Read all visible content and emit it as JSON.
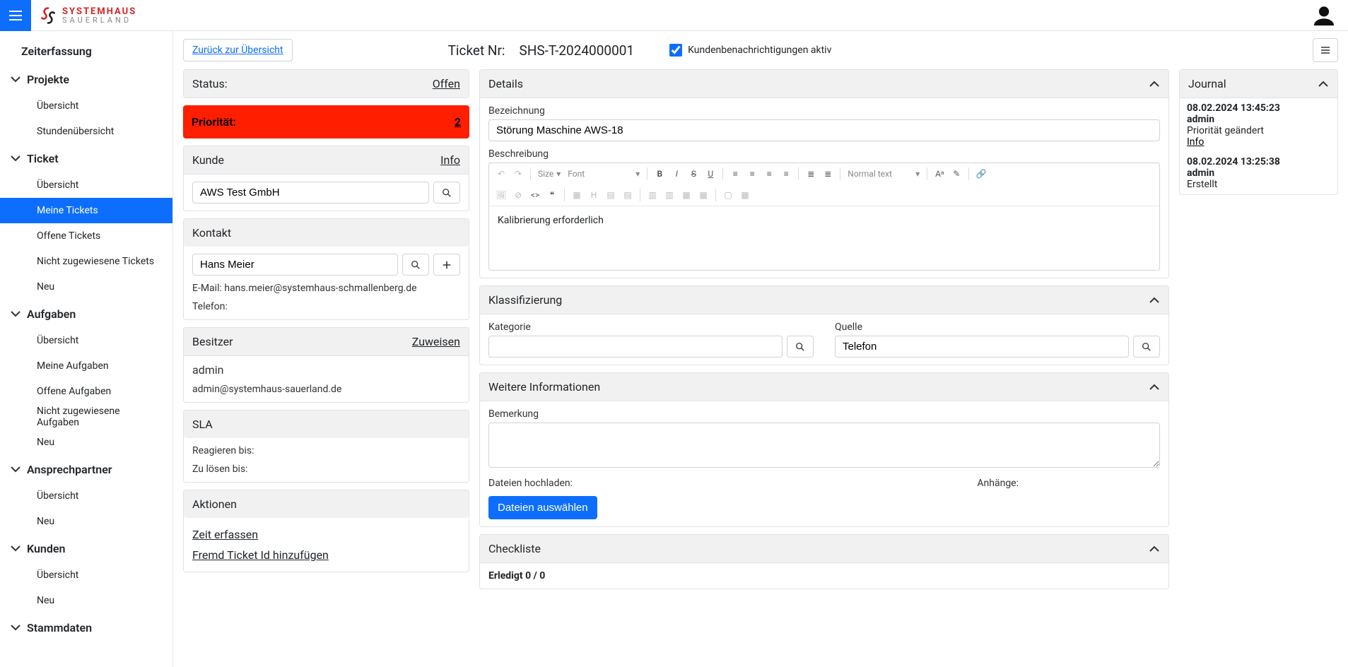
{
  "brand": {
    "line1": "SYSTEMHAUS",
    "line2": "SAUERLAND"
  },
  "sidebar": {
    "top": "Zeiterfassung",
    "groups": [
      {
        "title": "Projekte",
        "items": [
          "Übersicht",
          "Stundenübersicht"
        ]
      },
      {
        "title": "Ticket",
        "items": [
          "Übersicht",
          "Meine Tickets",
          "Offene Tickets",
          "Nicht zugewiesene Tickets",
          "Neu"
        ],
        "activeIndex": 1
      },
      {
        "title": "Aufgaben",
        "items": [
          "Übersicht",
          "Meine Aufgaben",
          "Offene Aufgaben",
          "Nicht zugewiesene Aufgaben",
          "Neu"
        ]
      },
      {
        "title": "Ansprechpartner",
        "items": [
          "Übersicht",
          "Neu"
        ]
      },
      {
        "title": "Kunden",
        "items": [
          "Übersicht",
          "Neu"
        ]
      },
      {
        "title": "Stammdaten",
        "items": []
      }
    ]
  },
  "header": {
    "back": "Zurück zur Übersicht",
    "title_label": "Ticket Nr:",
    "title_value": "SHS-T-2024000001",
    "notify_label": "Kundenbenachrichtigungen aktiv",
    "notify_checked": true
  },
  "left": {
    "status": {
      "label": "Status:",
      "value": "Offen"
    },
    "prio": {
      "label": "Priorität:",
      "value": "2",
      "color": "#ff1e00"
    },
    "kunde": {
      "label": "Kunde",
      "info": "Info",
      "value": "AWS Test GmbH"
    },
    "kontakt": {
      "label": "Kontakt",
      "value": "Hans Meier",
      "email_label": "E-Mail:",
      "email": "hans.meier@systemhaus-schmallenberg.de",
      "tel_label": "Telefon:",
      "tel": ""
    },
    "besitzer": {
      "label": "Besitzer",
      "assign": "Zuweisen",
      "name": "admin",
      "mail": "admin@systemhaus-sauerland.de"
    },
    "sla": {
      "label": "SLA",
      "react": "Reagieren bis:",
      "solve": "Zu lösen bis:"
    },
    "aktionen": {
      "label": "Aktionen",
      "items": [
        "Zeit erfassen",
        "Fremd Ticket Id hinzufügen"
      ]
    }
  },
  "mid": {
    "details": {
      "label": "Details",
      "name_label": "Bezeichnung",
      "name_value": "Störung Maschine AWS-18",
      "desc_label": "Beschreibung",
      "desc_value": "Kalibrierung erforderlich",
      "tb_size": "Size",
      "tb_font": "Font",
      "tb_normal": "Normal text"
    },
    "klass": {
      "label": "Klassifizierung",
      "kat_label": "Kategorie",
      "kat_value": "",
      "quelle_label": "Quelle",
      "quelle_value": "Telefon"
    },
    "weitere": {
      "label": "Weitere Informationen",
      "bem_label": "Bemerkung",
      "upload_label": "Dateien hochladen:",
      "attach_label": "Anhänge:",
      "choose_btn": "Dateien auswählen"
    },
    "check": {
      "label": "Checkliste",
      "done": "Erledigt 0 / 0"
    }
  },
  "journal": {
    "label": "Journal",
    "entries": [
      {
        "ts": "08.02.2024 13:45:23",
        "who": "admin",
        "what": "Priorität geändert",
        "info": "Info"
      },
      {
        "ts": "08.02.2024 13:25:38",
        "who": "admin",
        "what": "Erstellt"
      }
    ]
  }
}
